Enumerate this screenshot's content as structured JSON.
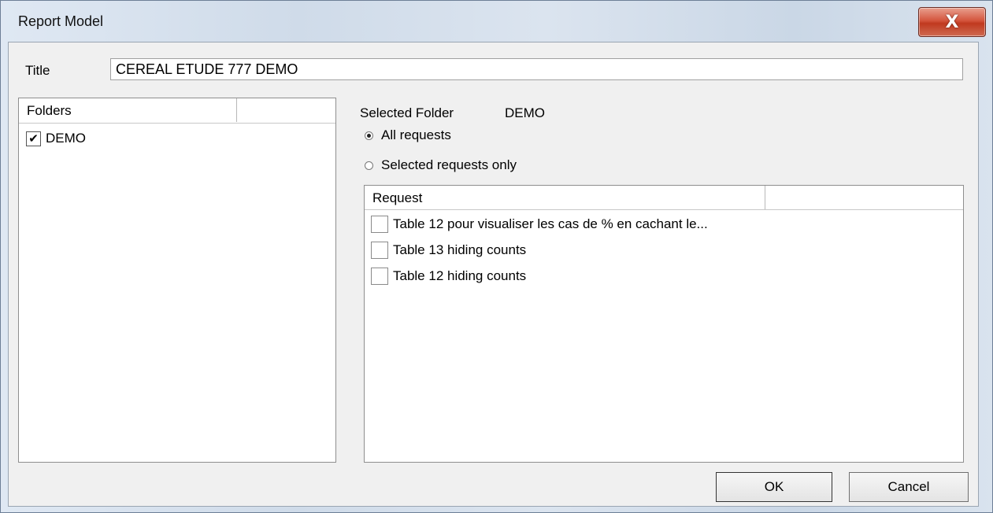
{
  "window": {
    "title": "Report Model",
    "close_glyph": "X"
  },
  "title_field": {
    "label": "Title",
    "value": "CEREAL ETUDE 777 DEMO"
  },
  "folders": {
    "header": "Folders",
    "items": [
      {
        "label": "DEMO",
        "checked": true
      }
    ]
  },
  "selected_folder": {
    "label": "Selected Folder",
    "value": "DEMO"
  },
  "scope": {
    "options": [
      {
        "label": "All requests",
        "selected": true
      },
      {
        "label": "Selected requests only",
        "selected": false
      }
    ]
  },
  "requests": {
    "header": "Request",
    "items": [
      {
        "label": "Table 12 pour visualiser les cas de % en cachant le...",
        "checked": false
      },
      {
        "label": "Table 13 hiding counts",
        "checked": false
      },
      {
        "label": "Table 12  hiding counts",
        "checked": false
      }
    ]
  },
  "buttons": {
    "ok": "OK",
    "cancel": "Cancel"
  },
  "icons": {
    "close": "close-icon",
    "checkbox_checked": "checkmark-icon"
  }
}
